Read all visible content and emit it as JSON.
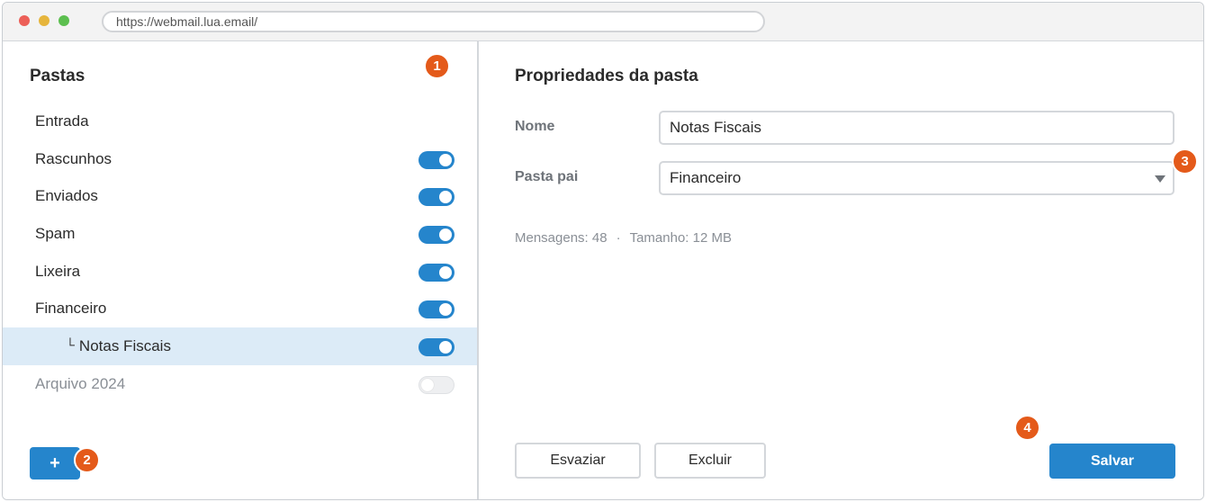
{
  "browser": {
    "url": "https://webmail.lua.email/"
  },
  "sidebar": {
    "title": "Pastas",
    "add_label": "+",
    "folders": [
      {
        "label": "Entrada",
        "toggle": null
      },
      {
        "label": "Rascunhos",
        "toggle": "on"
      },
      {
        "label": "Enviados",
        "toggle": "on"
      },
      {
        "label": "Spam",
        "toggle": "on"
      },
      {
        "label": "Lixeira",
        "toggle": "on"
      },
      {
        "label": "Financeiro",
        "toggle": "on"
      },
      {
        "label": "Notas Fiscais",
        "prefix": "└",
        "toggle": "on",
        "selected": true
      },
      {
        "label": "Arquivo 2024",
        "toggle": "off",
        "disabled": true
      }
    ]
  },
  "main": {
    "title": "Propriedades da pasta",
    "name_label": "Nome",
    "name_value": "Notas Fiscais",
    "parent_label": "Pasta pai",
    "parent_value": "Financeiro",
    "messages": "Mensagens: 48",
    "separator": "·",
    "size": "Tamanho: 12 MB",
    "empty_button": "Esvaziar",
    "delete_button": "Excluir",
    "save_button": "Salvar"
  },
  "badges": {
    "b1": "1",
    "b2": "2",
    "b3": "3",
    "b4": "4"
  },
  "colors": {
    "accent": "#2585cc",
    "badge": "#e45a1a",
    "selected_row": "#dcebf7"
  }
}
